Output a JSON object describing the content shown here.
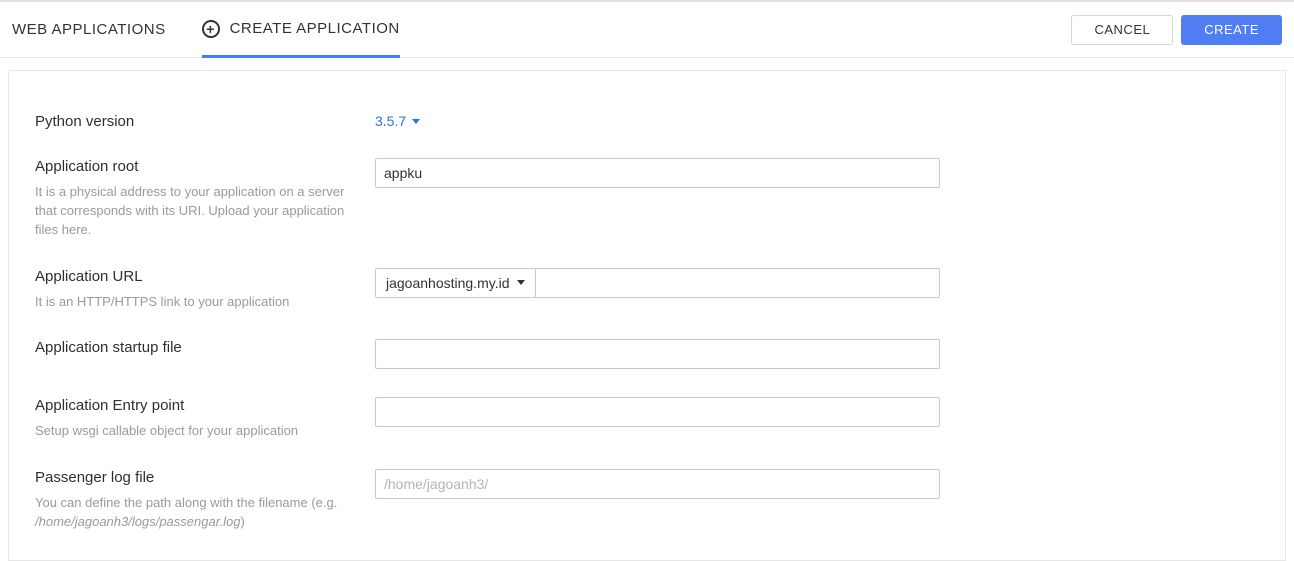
{
  "tabs": {
    "web_apps": "WEB APPLICATIONS",
    "create_app": "CREATE APPLICATION"
  },
  "actions": {
    "cancel": "CANCEL",
    "create": "CREATE"
  },
  "form": {
    "python_version": {
      "label": "Python version",
      "value": "3.5.7"
    },
    "app_root": {
      "label": "Application root",
      "help": "It is a physical address to your application on a server that corresponds with its URI. Upload your application files here.",
      "value": "appku"
    },
    "app_url": {
      "label": "Application URL",
      "help": "It is an HTTP/HTTPS link to your application",
      "domain": "jagoanhosting.my.id",
      "path": ""
    },
    "startup_file": {
      "label": "Application startup file",
      "value": ""
    },
    "entry_point": {
      "label": "Application Entry point",
      "help": "Setup wsgi callable object for your application",
      "value": ""
    },
    "passenger_log": {
      "label": "Passenger log file",
      "help_prefix": "You can define the path along with the filename (e.g.",
      "help_example": "/home/jagoanh3/logs/passengar.log",
      "help_suffix": ")",
      "placeholder": "/home/jagoanh3/",
      "value": ""
    }
  }
}
